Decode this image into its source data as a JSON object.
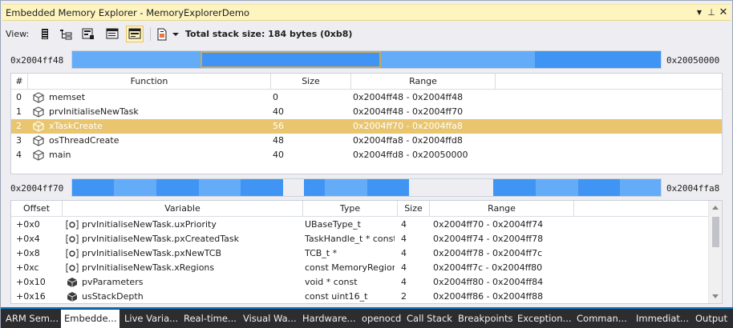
{
  "window": {
    "title": "Embedded Memory Explorer - MemoryExplorerDemo",
    "buttons": {
      "menu": "▼",
      "pin": "⊥",
      "close": "✕"
    }
  },
  "toolbar": {
    "view_label": "View:",
    "icons": [
      "stack-view-icon",
      "tree-view-icon",
      "memory-map-icon",
      "list-details-icon",
      "stack-frame-icon",
      "export-icon"
    ],
    "total_stack": "Total stack size: 184 bytes (0xb8)"
  },
  "map1": {
    "start": "0x2004ff48",
    "end": "0x20050000",
    "colors": {
      "dark": "#3f94f4",
      "light": "#64acf8",
      "selected_outline": "#c9a85d"
    }
  },
  "functions": {
    "headers": [
      "#",
      "Function",
      "Size",
      "Range"
    ],
    "rows": [
      {
        "idx": "0",
        "name": "memset",
        "size": "0",
        "range": "0x2004ff48 - 0x2004ff48"
      },
      {
        "idx": "1",
        "name": "prvInitialiseNewTask",
        "size": "40",
        "range": "0x2004ff48 - 0x2004ff70"
      },
      {
        "idx": "2",
        "name": "xTaskCreate",
        "size": "56",
        "range": "0x2004ff70 - 0x2004ffa8"
      },
      {
        "idx": "3",
        "name": "osThreadCreate",
        "size": "48",
        "range": "0x2004ffa8 - 0x2004ffd8"
      },
      {
        "idx": "4",
        "name": "main",
        "size": "40",
        "range": "0x2004ffd8 - 0x20050000"
      }
    ],
    "selected_index": 2,
    "selection_color": "#e8c56e"
  },
  "map2": {
    "start": "0x2004ff70",
    "end": "0x2004ffa8"
  },
  "variables": {
    "headers": [
      "Offset",
      "Variable",
      "Type",
      "Size",
      "Range"
    ],
    "rows": [
      {
        "offset": "+0x0",
        "name": "prvInitialiseNewTask.uxPriority",
        "type": "UBaseType_t",
        "size": "4",
        "range": "0x2004ff70 - 0x2004ff74",
        "icon": "field-icon"
      },
      {
        "offset": "+0x4",
        "name": "prvInitialiseNewTask.pxCreatedTask",
        "type": "TaskHandle_t * const",
        "size": "4",
        "range": "0x2004ff74 - 0x2004ff78",
        "icon": "field-icon"
      },
      {
        "offset": "+0x8",
        "name": "prvInitialiseNewTask.pxNewTCB",
        "type": "TCB_t *",
        "size": "4",
        "range": "0x2004ff78 - 0x2004ff7c",
        "icon": "field-icon"
      },
      {
        "offset": "+0xc",
        "name": "prvInitialiseNewTask.xRegions",
        "type": "const MemoryRegion",
        "size": "4",
        "range": "0x2004ff7c - 0x2004ff80",
        "icon": "field-icon"
      },
      {
        "offset": "+0x10",
        "name": "pvParameters",
        "type": "void * const",
        "size": "4",
        "range": "0x2004ff80 - 0x2004ff84",
        "icon": "variable-icon"
      },
      {
        "offset": "+0x16",
        "name": "usStackDepth",
        "type": "const uint16_t",
        "size": "2",
        "range": "0x2004ff86 - 0x2004ff88",
        "icon": "variable-icon"
      }
    ]
  },
  "tabs": [
    {
      "label": "ARM Sem...",
      "active": false
    },
    {
      "label": "Embedde...",
      "active": true
    },
    {
      "label": "Live Varia...",
      "active": false
    },
    {
      "label": "Real-time...",
      "active": false
    },
    {
      "label": "Visual Wa...",
      "active": false
    },
    {
      "label": "Hardware...",
      "active": false
    },
    {
      "label": "openocd",
      "active": false
    },
    {
      "label": "Call Stack",
      "active": false
    },
    {
      "label": "Breakpoints",
      "active": false
    },
    {
      "label": "Exception...",
      "active": false
    },
    {
      "label": "Comman...",
      "active": false
    },
    {
      "label": "Immediat...",
      "active": false
    },
    {
      "label": "Output",
      "active": false
    }
  ]
}
